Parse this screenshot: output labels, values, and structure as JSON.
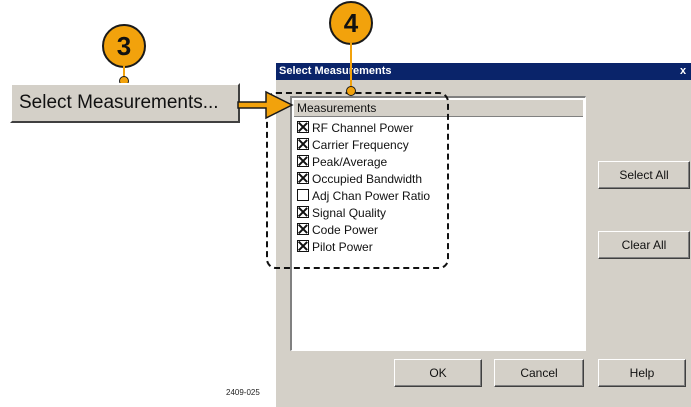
{
  "steps": {
    "step_a": "3",
    "step_b": "4"
  },
  "launch_button": {
    "label": "Select Measurements..."
  },
  "dialog": {
    "title": "Select Measurements",
    "close_glyph": "x",
    "list_header": "Measurements",
    "items": [
      {
        "label": "RF Channel Power",
        "checked": true
      },
      {
        "label": "Carrier Frequency",
        "checked": true
      },
      {
        "label": "Peak/Average",
        "checked": true
      },
      {
        "label": "Occupied Bandwidth",
        "checked": true
      },
      {
        "label": "Adj Chan Power Ratio",
        "checked": false
      },
      {
        "label": "Signal Quality",
        "checked": true
      },
      {
        "label": "Code Power",
        "checked": true
      },
      {
        "label": "Pilot Power",
        "checked": true
      }
    ],
    "select_all": "Select All",
    "clear_all": "Clear All",
    "ok": "OK",
    "cancel": "Cancel",
    "help": "Help"
  },
  "figure_id": "2409-025",
  "colors": {
    "badge": "#f2a20c",
    "titlebar": "#0a246a",
    "dialog_bg": "#d4d0c8"
  }
}
